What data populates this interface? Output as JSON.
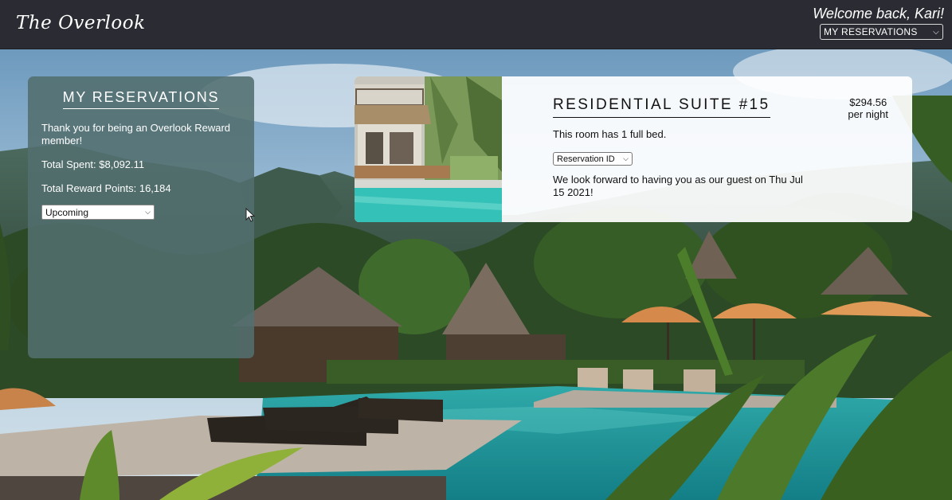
{
  "header": {
    "brand": "The Overlook",
    "welcome": "Welcome back, Kari!",
    "nav_select_value": "MY RESERVATIONS"
  },
  "panel": {
    "title": "MY RESERVATIONS",
    "thanks": "Thank you for being an Overlook Reward member!",
    "total_spent": "Total Spent: $8,092.11",
    "total_points": "Total Reward Points: 16,184",
    "filter_value": "Upcoming"
  },
  "reservation": {
    "room_title": "RESIDENTIAL SUITE #15",
    "room_desc": "This room has 1 full bed.",
    "select_value": "Reservation ID",
    "message": "We look forward to having you as our guest on Thu Jul 15 2021!",
    "price": "$294.56",
    "price_unit": "per night"
  },
  "colors": {
    "header_bg": "#2b2c33",
    "panel_bg": "#526e6e",
    "card_bg": "#ffffff"
  }
}
